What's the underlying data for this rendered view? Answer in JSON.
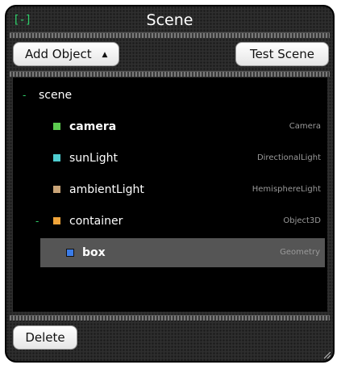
{
  "panel": {
    "collapse_label": "[-]",
    "title": "Scene"
  },
  "toolbar": {
    "add_object_label": "Add Object",
    "add_object_caret": "▲",
    "test_scene_label": "Test Scene"
  },
  "tree": {
    "root": {
      "toggle": "-",
      "name": "scene"
    },
    "items": [
      {
        "name": "camera",
        "type": "Camera",
        "color": "#5ccb4f",
        "bold": true,
        "selected": false
      },
      {
        "name": "sunLight",
        "type": "DirectionalLight",
        "color": "#4ecdd0",
        "bold": false,
        "selected": false
      },
      {
        "name": "ambientLight",
        "type": "HemisphereLight",
        "color": "#c9a477",
        "bold": false,
        "selected": false
      },
      {
        "name": "container",
        "type": "Object3D",
        "color": "#f0a43a",
        "bold": false,
        "selected": false,
        "toggle": "-"
      },
      {
        "name": "box",
        "type": "Geometry",
        "color": "#3b7ce8",
        "bold": false,
        "selected": true
      }
    ]
  },
  "footer": {
    "delete_label": "Delete"
  },
  "icons": {
    "collapse": "collapse-icon",
    "dropdown": "caret-up-icon",
    "resize": "resize-grip-icon"
  }
}
